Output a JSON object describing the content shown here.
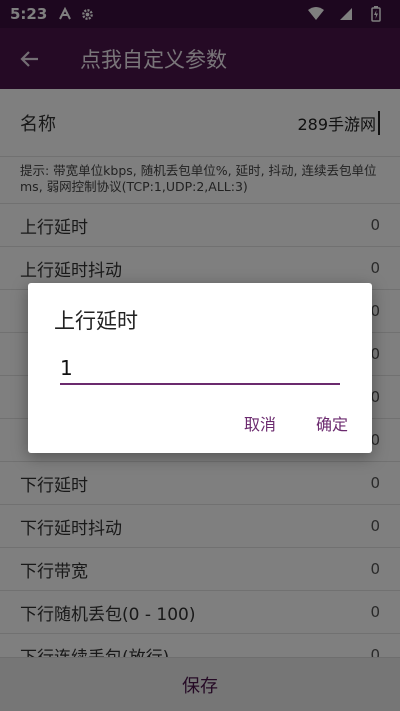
{
  "status_bar": {
    "time": "5:23",
    "icons": [
      "a-icon",
      "gear-icon",
      "wifi-icon",
      "signal-icon",
      "battery-icon"
    ]
  },
  "app_bar": {
    "title": "点我自定义参数",
    "back_icon": "arrow-back-icon"
  },
  "form": {
    "name_label": "名称",
    "name_value": "289手游网",
    "hint": "提示: 带宽单位kbps, 随机丢包单位%, 延时, 抖动, 连续丢包单位ms, 弱网控制协议(TCP:1,UDP:2,ALL:3)",
    "rows": [
      {
        "label": "上行延时",
        "value": "0"
      },
      {
        "label": "上行延时抖动",
        "value": "0"
      },
      {
        "label": "",
        "value": "0"
      },
      {
        "label": "",
        "value": "0"
      },
      {
        "label": "",
        "value": "0"
      },
      {
        "label": "",
        "value": "0"
      },
      {
        "label": "下行延时",
        "value": "0"
      },
      {
        "label": "下行延时抖动",
        "value": "0"
      },
      {
        "label": "下行带宽",
        "value": "0"
      },
      {
        "label": "下行随机丢包(0 - 100)",
        "value": "0"
      },
      {
        "label": "下行连续丢包(放行)",
        "value": "0"
      }
    ]
  },
  "bottom": {
    "save_label": "保存"
  },
  "dialog": {
    "title": "上行延时",
    "input_value": "1",
    "cancel_label": "取消",
    "confirm_label": "确定"
  },
  "colors": {
    "primary": "#4a154b",
    "status_bar": "#3a0f3f",
    "accent": "#6b2a6e"
  }
}
